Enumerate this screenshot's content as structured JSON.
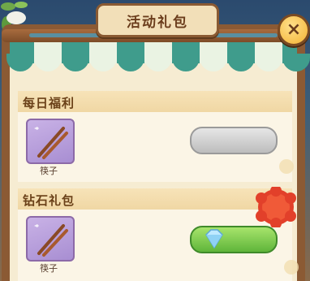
{
  "panel": {
    "title": "活动礼包",
    "close_symbol": "×"
  },
  "sections": [
    {
      "title": "每日福利",
      "item": {
        "icon": "chopsticks-icon",
        "label": "筷子"
      },
      "button": {
        "state": "disabled",
        "color": "#c8c8c8"
      }
    },
    {
      "title": "钻石礼包",
      "item": {
        "icon": "chopsticks-icon",
        "label": "筷子"
      },
      "button": {
        "state": "active",
        "icon": "diamond-icon",
        "color": "#7cc84a"
      }
    }
  ],
  "colors": {
    "awning_green": "#3f9c8c",
    "wood": "#8b5a34",
    "badge_red": "#e2402a"
  }
}
